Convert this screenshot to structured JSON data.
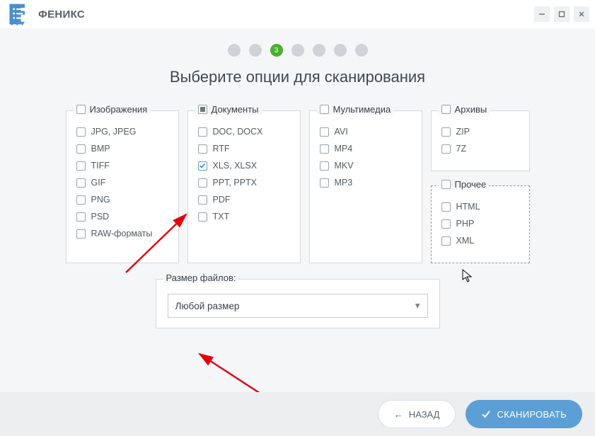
{
  "app": {
    "title": "ФЕНИКС"
  },
  "stepper": {
    "active_index": 2,
    "active_label": "3",
    "count": 7
  },
  "heading": "Выберите опции для сканирования",
  "groups": {
    "images": {
      "title": "Изображения",
      "state": "unchecked",
      "items": [
        "JPG, JPEG",
        "BMP",
        "TIFF",
        "GIF",
        "PNG",
        "PSD",
        "RAW-форматы"
      ]
    },
    "documents": {
      "title": "Документы",
      "state": "indeterminate",
      "items": [
        {
          "label": "DOC, DOCX",
          "checked": false
        },
        {
          "label": "RTF",
          "checked": false
        },
        {
          "label": "XLS, XLSX",
          "checked": true
        },
        {
          "label": "PPT, PPTX",
          "checked": false
        },
        {
          "label": "PDF",
          "checked": false
        },
        {
          "label": "TXT",
          "checked": false
        }
      ]
    },
    "multimedia": {
      "title": "Мультимедиа",
      "state": "unchecked",
      "items": [
        "AVI",
        "MP4",
        "MKV",
        "MP3"
      ]
    },
    "archives": {
      "title": "Архивы",
      "state": "unchecked",
      "items": [
        "ZIP",
        "7Z"
      ]
    },
    "other": {
      "title": "Прочее",
      "state": "unchecked",
      "items": [
        "HTML",
        "PHP",
        "XML"
      ]
    }
  },
  "filesize": {
    "title": "Размер файлов:",
    "selected": "Любой размер"
  },
  "buttons": {
    "back": "НАЗАД",
    "scan": "СКАНИРОВАТЬ"
  }
}
